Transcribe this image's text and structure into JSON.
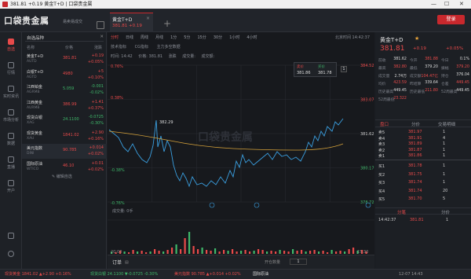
{
  "window": {
    "title": "381.81 +0.19 黄金T+D | 口袋贵金属",
    "minimize": "—",
    "maximize": "☐",
    "close": "✕"
  },
  "header": {
    "logo": "口袋贵金属",
    "slogan": "易卖易成交",
    "tab_name": "黄金T+D",
    "tab_value": "381.81  +0.19",
    "tab_close": "×",
    "add_tab": "+",
    "login": "登录"
  },
  "sidebar": {
    "items": [
      {
        "label": "自选",
        "icon": "star-icon"
      },
      {
        "label": "行情",
        "icon": "chart-icon"
      },
      {
        "label": "实时资讯",
        "icon": "news-icon"
      },
      {
        "label": "市场分析",
        "icon": "analysis-icon"
      },
      {
        "label": "数据",
        "icon": "data-icon"
      },
      {
        "label": "直播",
        "icon": "live-icon"
      },
      {
        "label": "开户",
        "icon": "account-icon"
      }
    ],
    "mail_icon": "mail-icon",
    "settings_icon": "gear-icon"
  },
  "watchlist": {
    "title": "自选品种",
    "close": "✕",
    "columns": [
      "名称",
      "价格",
      "涨跌"
    ],
    "rows": [
      {
        "name": "黄金T+D",
        "code": "AUTD",
        "price": "381.81",
        "change": "+0.19",
        "pct": "+0.05%",
        "dir": "red"
      },
      {
        "name": "白银T+D",
        "code": "AGTD",
        "price": "4980",
        "change": "+5",
        "pct": "+0.10%",
        "dir": "red"
      },
      {
        "name": "江西铂金",
        "code": "AGRMB",
        "price": "5.059",
        "change": "-0.001",
        "pct": "-0.02%",
        "dir": "green"
      },
      {
        "name": "江西黄金",
        "code": "AURMB",
        "price": "386.99",
        "change": "+1.41",
        "pct": "+0.37%",
        "dir": "red"
      },
      {
        "name": "现货白银",
        "code": "XAG",
        "price": "24.1100",
        "change": "-0.0725",
        "pct": "-0.30%",
        "dir": "green"
      },
      {
        "name": "现货黄金",
        "code": "XAU",
        "price": "1841.02",
        "change": "+2.90",
        "pct": "+0.16%",
        "dir": "red"
      },
      {
        "name": "美元指数",
        "code": "DINI",
        "price": "90.785",
        "change": "+0.014",
        "pct": "+0.02%",
        "dir": "red"
      },
      {
        "name": "国际原油",
        "code": "WTICO",
        "price": "46.10",
        "change": "+0.01",
        "pct": "+0.02%",
        "dir": "red"
      }
    ],
    "edit": "编辑自选"
  },
  "chart": {
    "period_tabs": [
      "分时",
      "日线",
      "周线",
      "月线",
      "1分",
      "5分",
      "15分",
      "30分",
      "1小时",
      "4小时"
    ],
    "clock": "北京时间 14:42:37",
    "sub_tabs": [
      "技术指标",
      "CG指标",
      "主力多空数据"
    ],
    "meta": {
      "time": "时间: 14:42",
      "price": "价格: 381.81",
      "change": "涨跌",
      "volume": "成交量:",
      "turnover": "成交额:"
    },
    "left_pct": [
      "0.76%",
      "0.38%",
      "-0.38%",
      "-0.76%"
    ],
    "right_axis": [
      "384.52",
      "383.07",
      "381.62",
      "380.17",
      "378.72"
    ],
    "high_label": "382.29",
    "quote_box": {
      "sell_label": "卖价",
      "buy_label": "买价",
      "sell_price": "381.86",
      "buy_price": "381.78",
      "qty": "1"
    },
    "volume_label": "成交量: 0手",
    "time_axis": [
      "20:00",
      "",
      "",
      "",
      "",
      "",
      "15:30"
    ],
    "watermark": "口袋贵金属"
  },
  "chart_data": {
    "type": "line",
    "series": [],
    "ylim": [
      378.72,
      384.52
    ],
    "y_ticks": [
      384.52,
      383.07,
      381.62,
      380.17,
      378.72
    ],
    "x_ticks": [
      "20:00",
      "15:30"
    ],
    "high_mark": 382.29,
    "legend": "none"
  },
  "order": {
    "label": "订单",
    "open_label": "开仓数量",
    "qty": "1"
  },
  "detail": {
    "name": "黄金T+D",
    "star": "★",
    "price": "381.81",
    "change": "+0.19",
    "pct": "+0.05%",
    "stats": [
      [
        "前收",
        "381.62"
      ],
      [
        "今开",
        "381.88"
      ],
      [
        "今日",
        "0.1%"
      ],
      [
        "最高",
        "382.80"
      ],
      [
        "最低",
        "379.20"
      ],
      [
        "振幅",
        "379.20"
      ],
      [
        "成交量",
        "2.74万"
      ],
      [
        "成交额",
        "104.47亿"
      ],
      [
        "持仓",
        "376.04"
      ],
      [
        "均价",
        "423.59"
      ],
      [
        "昨结算",
        "339.64"
      ],
      [
        "仓差",
        "449.45"
      ],
      [
        "历史最高",
        "449.45"
      ],
      [
        "历史最低",
        "211.80"
      ],
      [
        "52周最高",
        "449.45"
      ],
      [
        "52周最低",
        "23.322"
      ]
    ],
    "tabs": [
      "盘口",
      "分价",
      "交易明细"
    ],
    "asks": [
      [
        "卖5",
        "381.97",
        "1"
      ],
      [
        "卖4",
        "381.91",
        "4"
      ],
      [
        "卖3",
        "381.89",
        "1"
      ],
      [
        "卖2",
        "381.87",
        "1"
      ],
      [
        "卖1",
        "381.86",
        "1"
      ]
    ],
    "bids": [
      [
        "买1",
        "381.78",
        "1"
      ],
      [
        "买2",
        "381.75",
        "1"
      ],
      [
        "买3",
        "381.74",
        "1"
      ],
      [
        "买4",
        "381.74",
        "20"
      ],
      [
        "买5",
        "381.70",
        "5"
      ]
    ],
    "trade_tabs": [
      "分笔",
      "分价"
    ],
    "trade": [
      "14:42:37",
      "381.81",
      "1"
    ]
  },
  "status": [
    {
      "text": "现货黄金 1841.02 ▲+2.90 +0.16%",
      "dir": "red"
    },
    {
      "text": "现货白银 24.1100 ▼-0.0725 -0.30%",
      "dir": "green"
    },
    {
      "text": "美元指数 90.785 ▲+0.014 +0.02%",
      "dir": "red"
    },
    {
      "text": "国际原油",
      "dir": "white"
    }
  ],
  "status_time": "12-07 14:43"
}
